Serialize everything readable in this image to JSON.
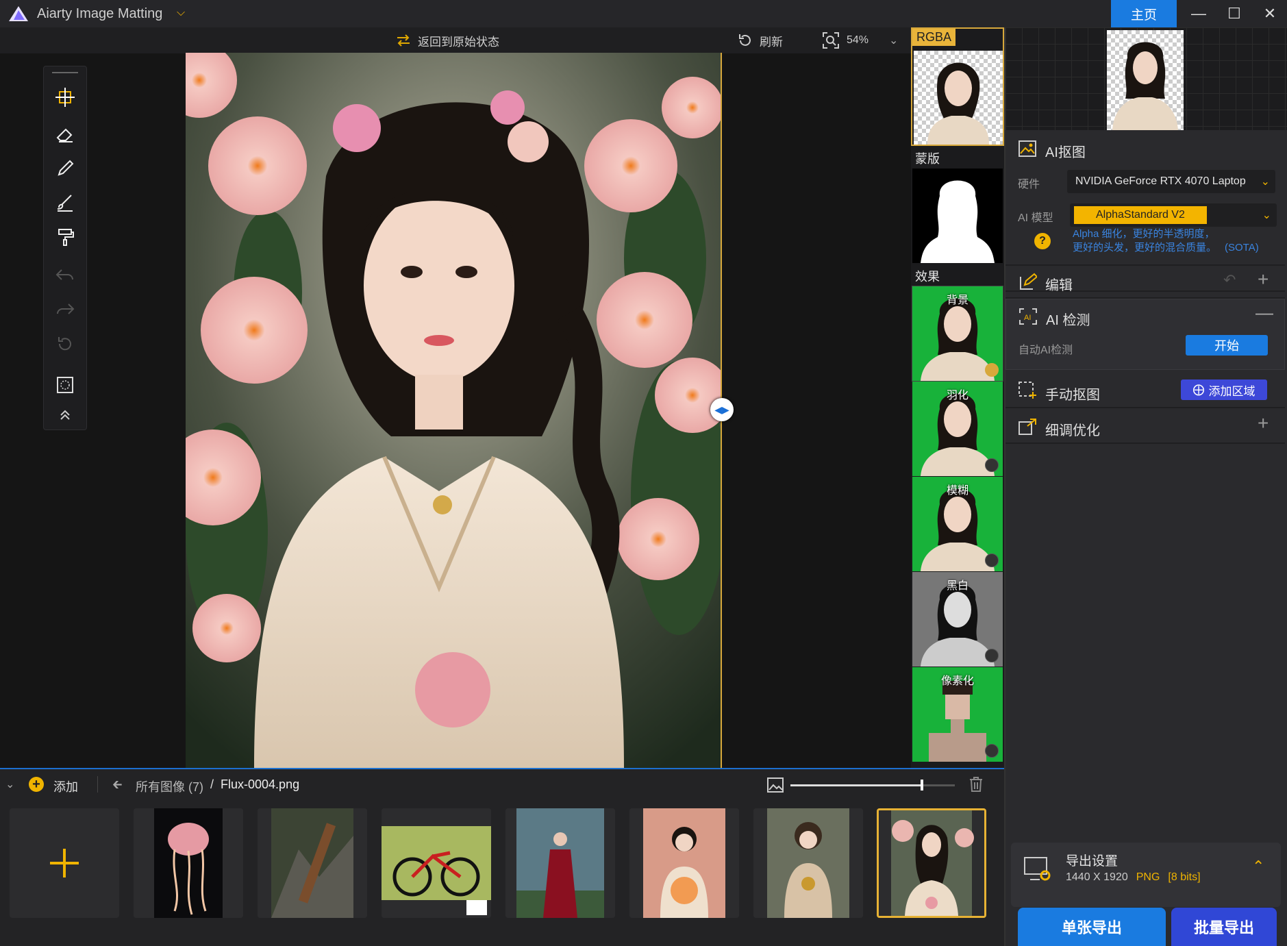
{
  "app": {
    "title": "Aiarty Image Matting",
    "home": "主页"
  },
  "toolbar": {
    "restore": "返回到原始状态",
    "refresh": "刷新",
    "zoom": "54%"
  },
  "strip": {
    "rgba": "RGBA",
    "mask": "蒙版",
    "effects": "效果",
    "effect_items": [
      "背景",
      "羽化",
      "模糊",
      "黑白",
      "像素化"
    ]
  },
  "panel": {
    "ai_cutout": {
      "title": "AI抠图",
      "hardware_label": "硬件",
      "hardware_value": "NVIDIA GeForce RTX 4070 Laptop",
      "model_label": "AI 模型",
      "model_value": "AlphaStandard  V2",
      "help_icon": "?",
      "model_desc_line1": "Alpha 细化，更好的半透明度，",
      "model_desc_line2": "更好的头发，更好的混合质量。",
      "model_tag": "(SOTA)"
    },
    "edit": {
      "title": "编辑"
    },
    "ai_detect": {
      "title": "AI 检测",
      "auto_label": "自动AI检测",
      "start": "开始"
    },
    "manual": {
      "title": "手动抠图",
      "add_region": "添加区域"
    },
    "refine": {
      "title": "细调优化"
    },
    "export": {
      "title": "导出设置",
      "size": "1440 X 1920",
      "format": "PNG",
      "bits": "[8 bits]"
    },
    "btn_single": "单张导出",
    "btn_batch": "批量导出"
  },
  "bottom": {
    "add": "添加",
    "all_images": "所有图像 (7)",
    "separator": "/",
    "filename": "Flux-0004.png",
    "size_slider": 0.8
  },
  "colors": {
    "accent": "#1a7be0",
    "highlight": "#f5b400",
    "green": "#18b23a"
  }
}
